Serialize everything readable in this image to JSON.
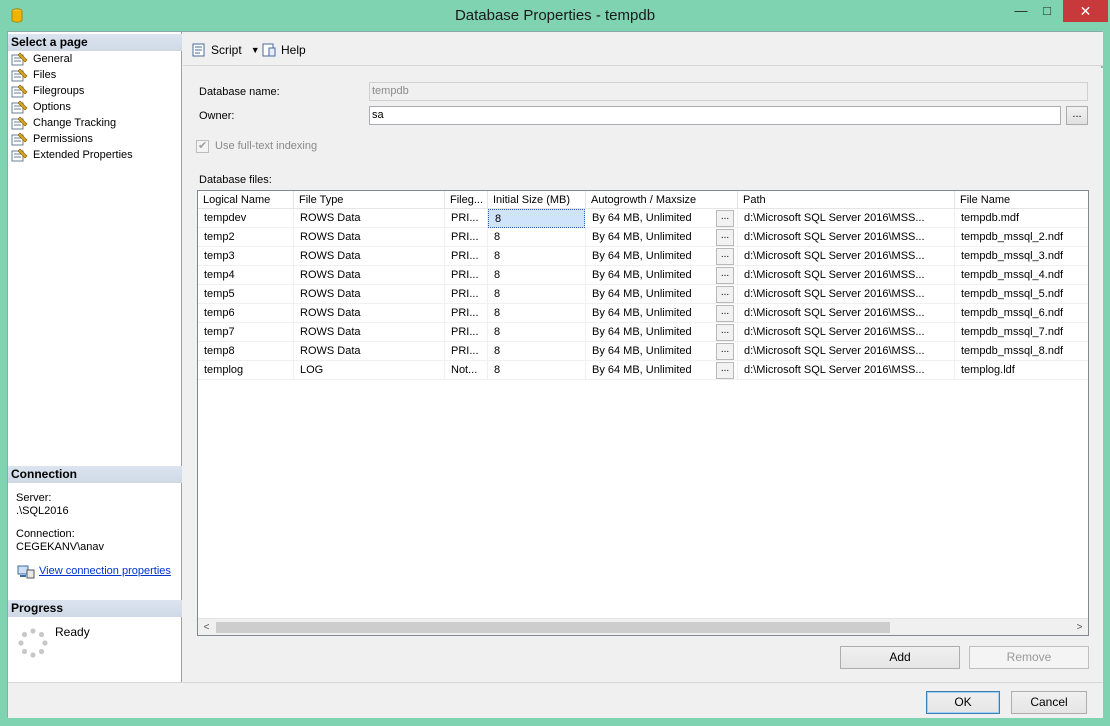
{
  "window": {
    "title": "Database Properties - tempdb",
    "controls": {
      "minimize": "—",
      "maximize": "□",
      "close": "✕"
    }
  },
  "left_panel": {
    "select_page_header": "Select a page",
    "pages": [
      {
        "label": "General",
        "icon": "wrench-page-icon"
      },
      {
        "label": "Files",
        "icon": "wrench-page-icon"
      },
      {
        "label": "Filegroups",
        "icon": "wrench-page-icon"
      },
      {
        "label": "Options",
        "icon": "wrench-page-icon"
      },
      {
        "label": "Change Tracking",
        "icon": "wrench-page-icon"
      },
      {
        "label": "Permissions",
        "icon": "wrench-page-icon"
      },
      {
        "label": "Extended Properties",
        "icon": "wrench-page-icon"
      }
    ],
    "connection_header": "Connection",
    "server_label": "Server:",
    "server_value": ".\\SQL2016",
    "connection_label": "Connection:",
    "connection_value": "CEGEKANV\\anav",
    "view_connection_link": "View connection properties",
    "progress_header": "Progress",
    "progress_status": "Ready"
  },
  "toolbar": {
    "script_label": "Script",
    "help_label": "Help"
  },
  "form": {
    "database_name_label": "Database name:",
    "database_name_value": "tempdb",
    "owner_label": "Owner:",
    "owner_value": "sa",
    "owner_browse": "...",
    "fulltext_label": "Use full-text indexing",
    "database_files_label": "Database files:"
  },
  "grid": {
    "columns": [
      "Logical Name",
      "File Type",
      "Fileg...",
      "Initial Size (MB)",
      "Autogrowth / Maxsize",
      "Path",
      "File Name"
    ],
    "cell_button": "...",
    "rows": [
      [
        "tempdev",
        "ROWS Data",
        "PRI...",
        "8",
        "By 64 MB, Unlimited",
        "d:\\Microsoft SQL Server 2016\\MSS...",
        "tempdb.mdf"
      ],
      [
        "temp2",
        "ROWS Data",
        "PRI...",
        "8",
        "By 64 MB, Unlimited",
        "d:\\Microsoft SQL Server 2016\\MSS...",
        "tempdb_mssql_2.ndf"
      ],
      [
        "temp3",
        "ROWS Data",
        "PRI...",
        "8",
        "By 64 MB, Unlimited",
        "d:\\Microsoft SQL Server 2016\\MSS...",
        "tempdb_mssql_3.ndf"
      ],
      [
        "temp4",
        "ROWS Data",
        "PRI...",
        "8",
        "By 64 MB, Unlimited",
        "d:\\Microsoft SQL Server 2016\\MSS...",
        "tempdb_mssql_4.ndf"
      ],
      [
        "temp5",
        "ROWS Data",
        "PRI...",
        "8",
        "By 64 MB, Unlimited",
        "d:\\Microsoft SQL Server 2016\\MSS...",
        "tempdb_mssql_5.ndf"
      ],
      [
        "temp6",
        "ROWS Data",
        "PRI...",
        "8",
        "By 64 MB, Unlimited",
        "d:\\Microsoft SQL Server 2016\\MSS...",
        "tempdb_mssql_6.ndf"
      ],
      [
        "temp7",
        "ROWS Data",
        "PRI...",
        "8",
        "By 64 MB, Unlimited",
        "d:\\Microsoft SQL Server 2016\\MSS...",
        "tempdb_mssql_7.ndf"
      ],
      [
        "temp8",
        "ROWS Data",
        "PRI...",
        "8",
        "By 64 MB, Unlimited",
        "d:\\Microsoft SQL Server 2016\\MSS...",
        "tempdb_mssql_8.ndf"
      ],
      [
        "templog",
        "LOG",
        "Not...",
        "8",
        "By 64 MB, Unlimited",
        "d:\\Microsoft SQL Server 2016\\MSS...",
        "templog.ldf"
      ]
    ]
  },
  "buttons": {
    "add": "Add",
    "remove": "Remove",
    "ok": "OK",
    "cancel": "Cancel"
  },
  "colors": {
    "frame": "#7fd3b1",
    "close": "#c7393b",
    "section_header": "#d3dce8",
    "selection": "#cfe3fa",
    "link": "#0033cc"
  }
}
